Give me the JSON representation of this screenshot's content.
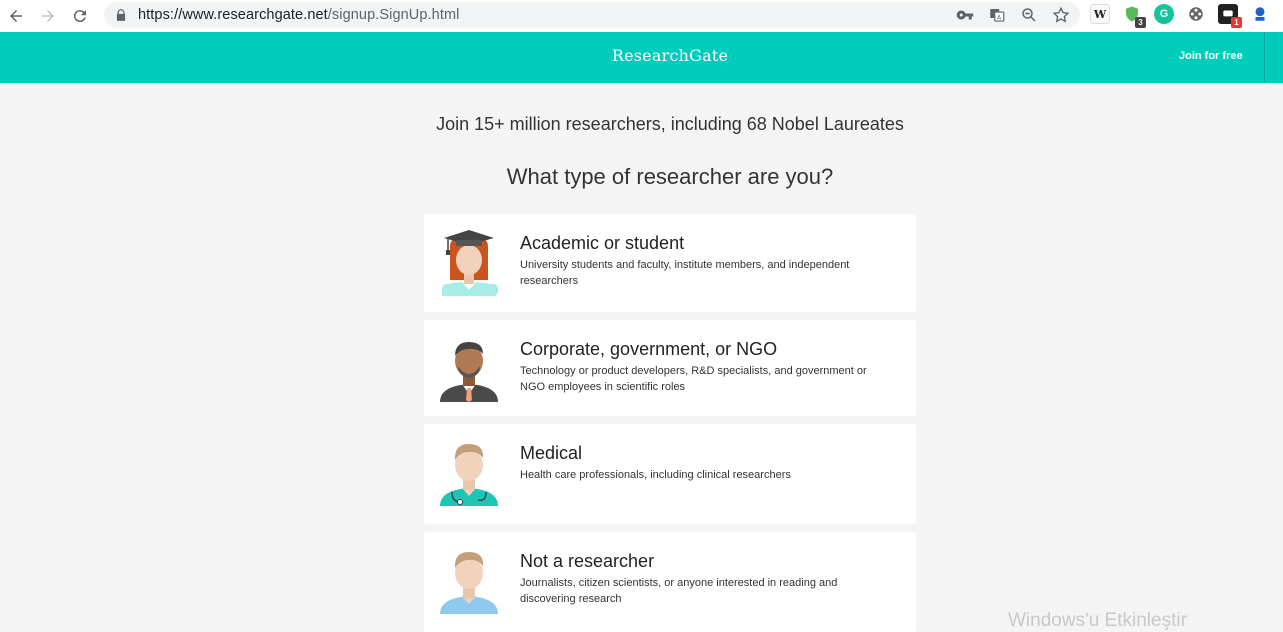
{
  "browser": {
    "url_domain": "https://www.researchgate.net",
    "url_path": "/signup.SignUp.html",
    "extensions": [
      {
        "name": "wikipedia-extension",
        "label": "W"
      },
      {
        "name": "shield-extension",
        "badge": "3"
      },
      {
        "name": "grammarly-extension",
        "label": "G"
      },
      {
        "name": "film-extension"
      },
      {
        "name": "notification-extension",
        "badge": "1"
      },
      {
        "name": "account-extension"
      }
    ]
  },
  "header": {
    "logo": "ResearchGate",
    "join_link": "Join for free",
    "color": "#00ccbb"
  },
  "main": {
    "subtitle": "Join 15+ million researchers, including 68 Nobel Laureates",
    "question": "What type of researcher are you?",
    "options": [
      {
        "title": "Academic or student",
        "desc": "University students and faculty, institute members, and independent researchers"
      },
      {
        "title": "Corporate, government, or NGO",
        "desc": "Technology or product developers, R&D specialists, and government or NGO employees in scientific roles"
      },
      {
        "title": "Medical",
        "desc": "Health care professionals, including clinical researchers"
      },
      {
        "title": "Not a researcher",
        "desc": "Journalists, citizen scientists, or anyone interested in reading and discovering research"
      }
    ]
  },
  "os": {
    "watermark": "Windows'u Etkinleştir"
  }
}
